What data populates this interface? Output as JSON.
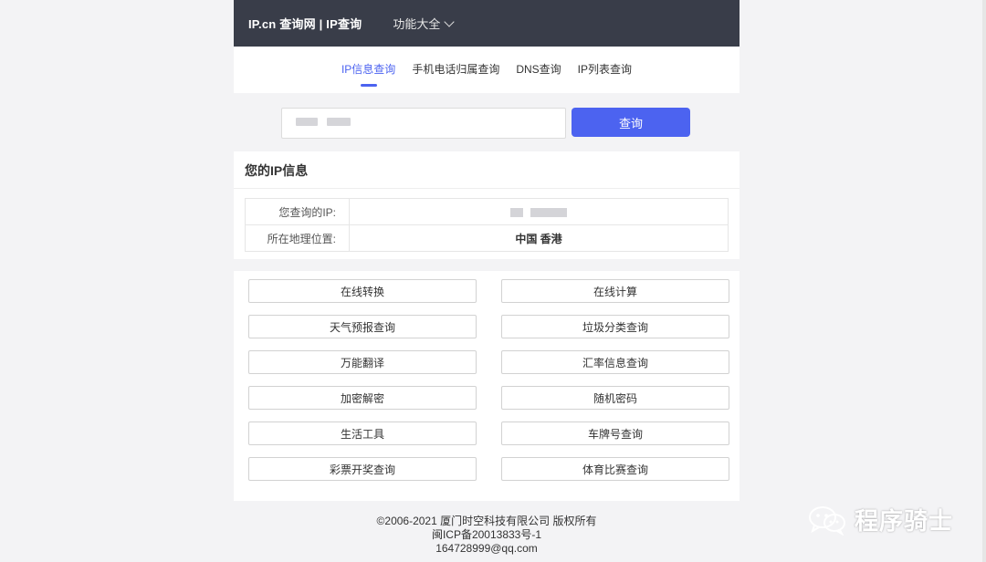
{
  "header": {
    "brand": "IP.cn 查询网 | IP查询",
    "menu_label": "功能大全"
  },
  "tabs": [
    {
      "label": "IP信息查询",
      "active": true
    },
    {
      "label": "手机电话归属查询",
      "active": false
    },
    {
      "label": "DNS查询",
      "active": false
    },
    {
      "label": "IP列表查询",
      "active": false
    }
  ],
  "search": {
    "button_label": "查询"
  },
  "ip_info": {
    "title": "您的IP信息",
    "rows": [
      {
        "key": "您查询的IP:"
      },
      {
        "key": "所在地理位置:",
        "value": "中国 香港"
      }
    ]
  },
  "tools": {
    "left": [
      "在线转换",
      "天气预报查询",
      "万能翻译",
      "加密解密",
      "生活工具",
      "彩票开奖查询"
    ],
    "right": [
      "在线计算",
      "垃圾分类查询",
      "汇率信息查询",
      "随机密码",
      "车牌号查询",
      "体育比赛查询"
    ]
  },
  "footer": {
    "line1": "©2006-2021 厦门时空科技有限公司 版权所有",
    "line2": "闽ICP备20013833号-1",
    "line3": "164728999@qq.com"
  },
  "watermark": {
    "text": "程序骑士",
    "icon": "wechat-icon"
  },
  "colors": {
    "accent": "#4c63f0",
    "header_bg": "#393d49",
    "page_bg": "#f3f3f5"
  }
}
